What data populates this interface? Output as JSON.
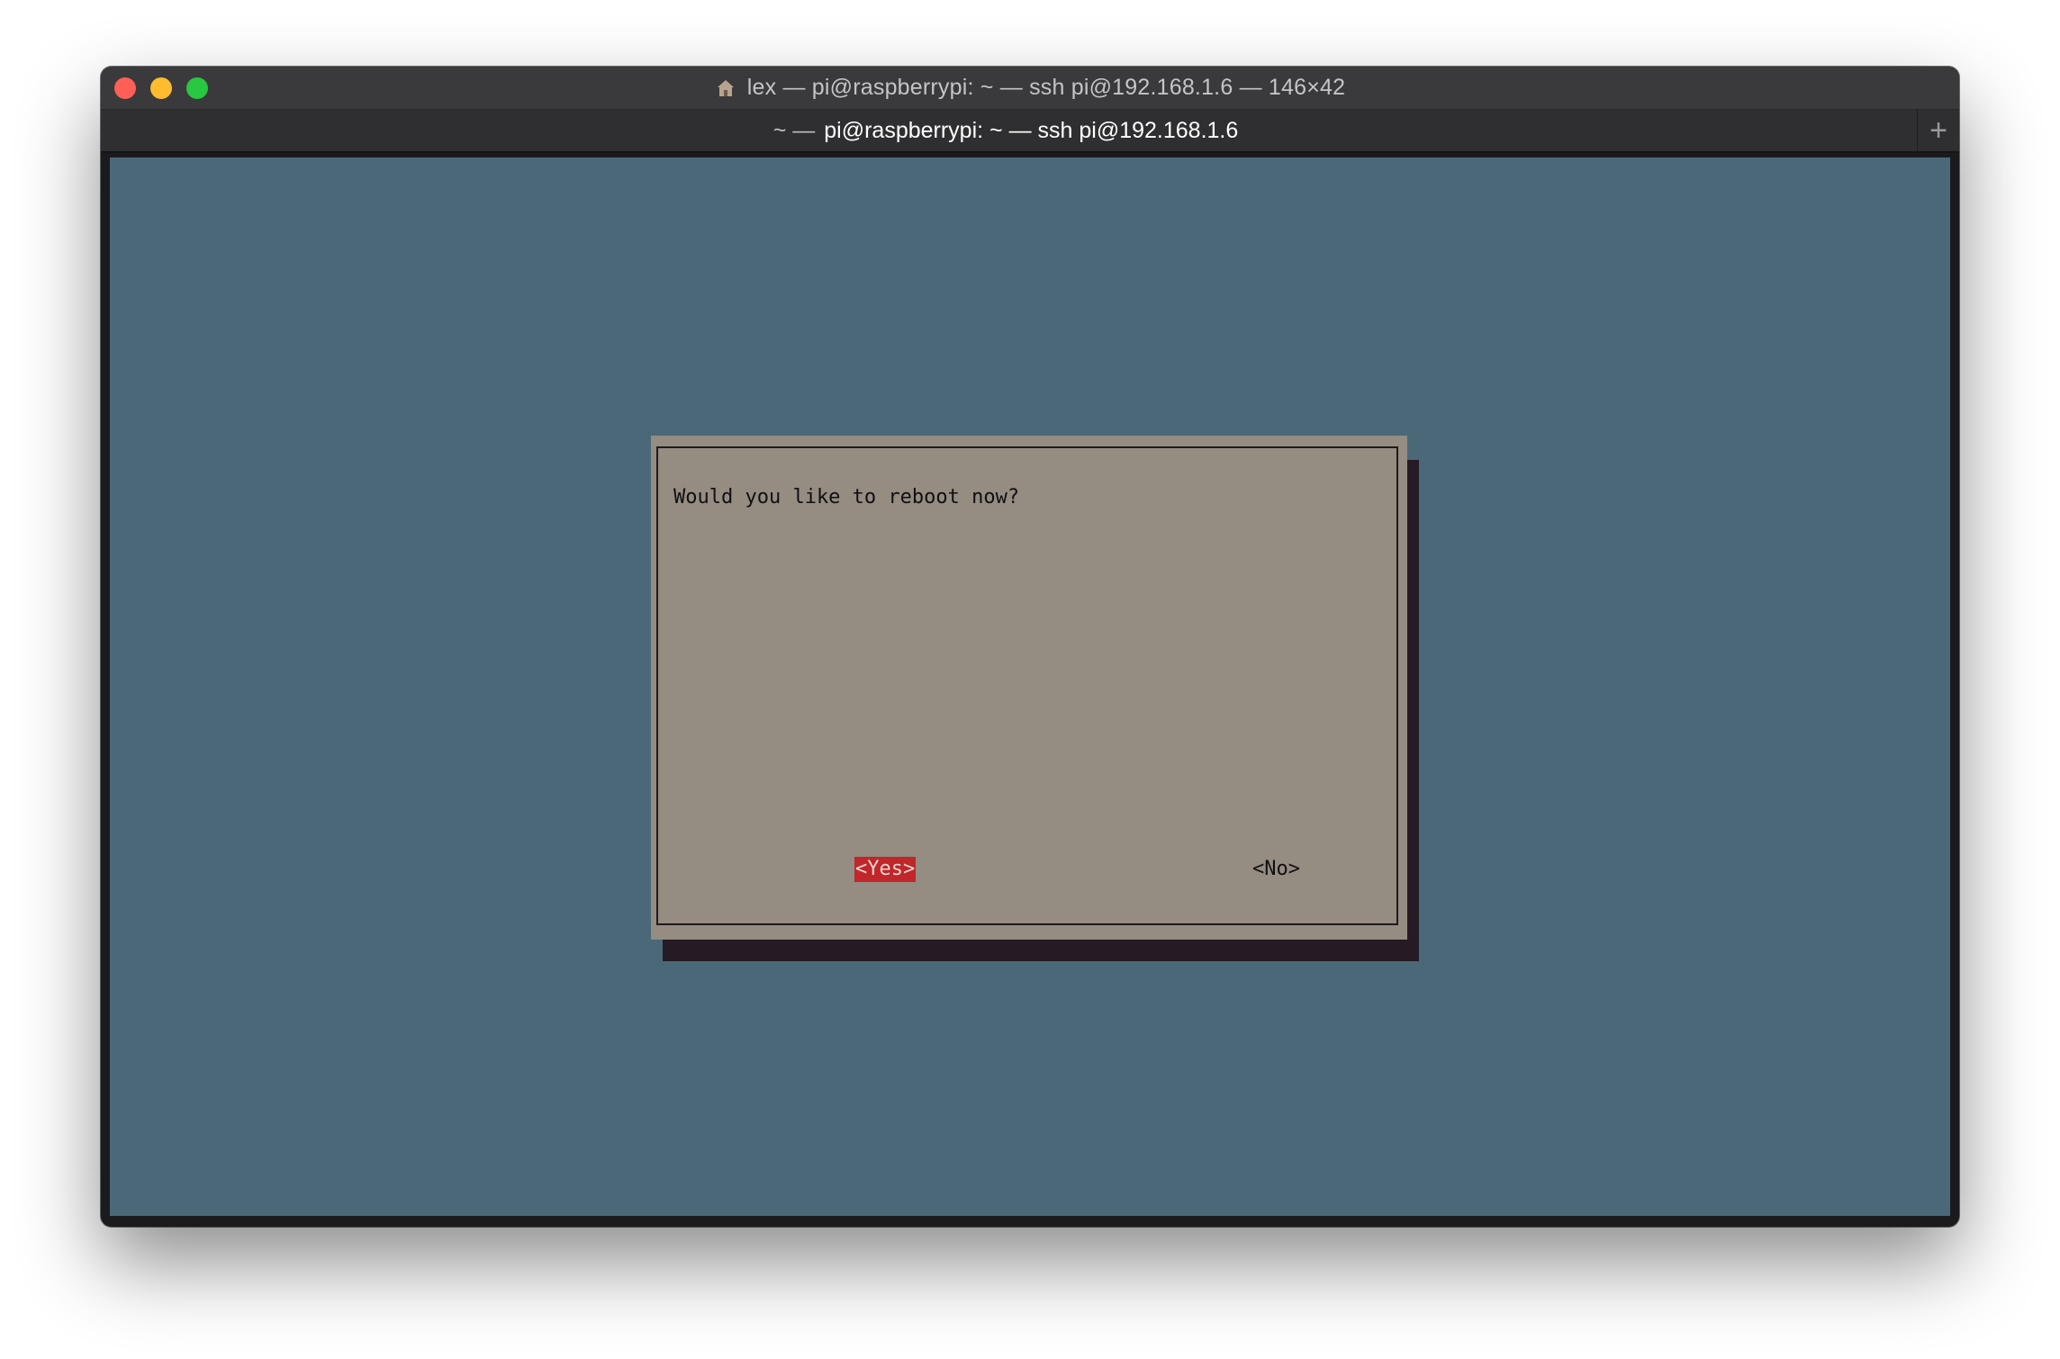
{
  "window": {
    "title": "lex — pi@raspberrypi: ~ — ssh pi@192.168.1.6 — 146×42",
    "title_icon": "home-icon"
  },
  "tab": {
    "prefix": "~ —",
    "title": "pi@raspberrypi: ~ — ssh pi@192.168.1.6",
    "new_tab_label": "+"
  },
  "colors": {
    "terminal_bg": "#4a6878",
    "dialog_bg": "#958c82",
    "selected_button": "#c0262a"
  },
  "dialog": {
    "message": "Would you like to reboot now?",
    "yes_label": "<Yes>",
    "no_label": "<No>",
    "selected": "yes"
  }
}
